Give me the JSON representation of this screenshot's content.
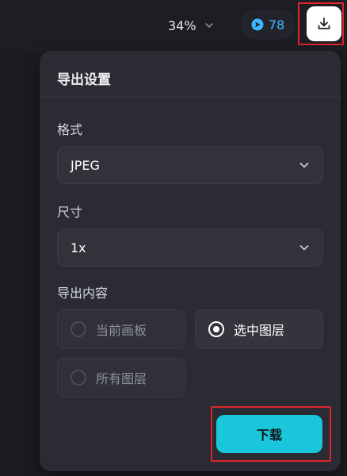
{
  "topbar": {
    "zoom": "34%",
    "credits": "78",
    "colors": {
      "credits_text": "#3fb7ff",
      "highlight": "#e0242a"
    }
  },
  "export_panel": {
    "title": "导出设置",
    "format": {
      "label": "格式",
      "value": "JPEG"
    },
    "size": {
      "label": "尺寸",
      "value": "1x"
    },
    "content": {
      "label": "导出内容",
      "options": [
        {
          "label": "当前画板",
          "state": "disabled"
        },
        {
          "label": "选中图层",
          "state": "selected"
        },
        {
          "label": "所有图层",
          "state": "disabled"
        }
      ]
    },
    "download_label": "下载",
    "colors": {
      "download_button": "#19c6dc"
    }
  }
}
